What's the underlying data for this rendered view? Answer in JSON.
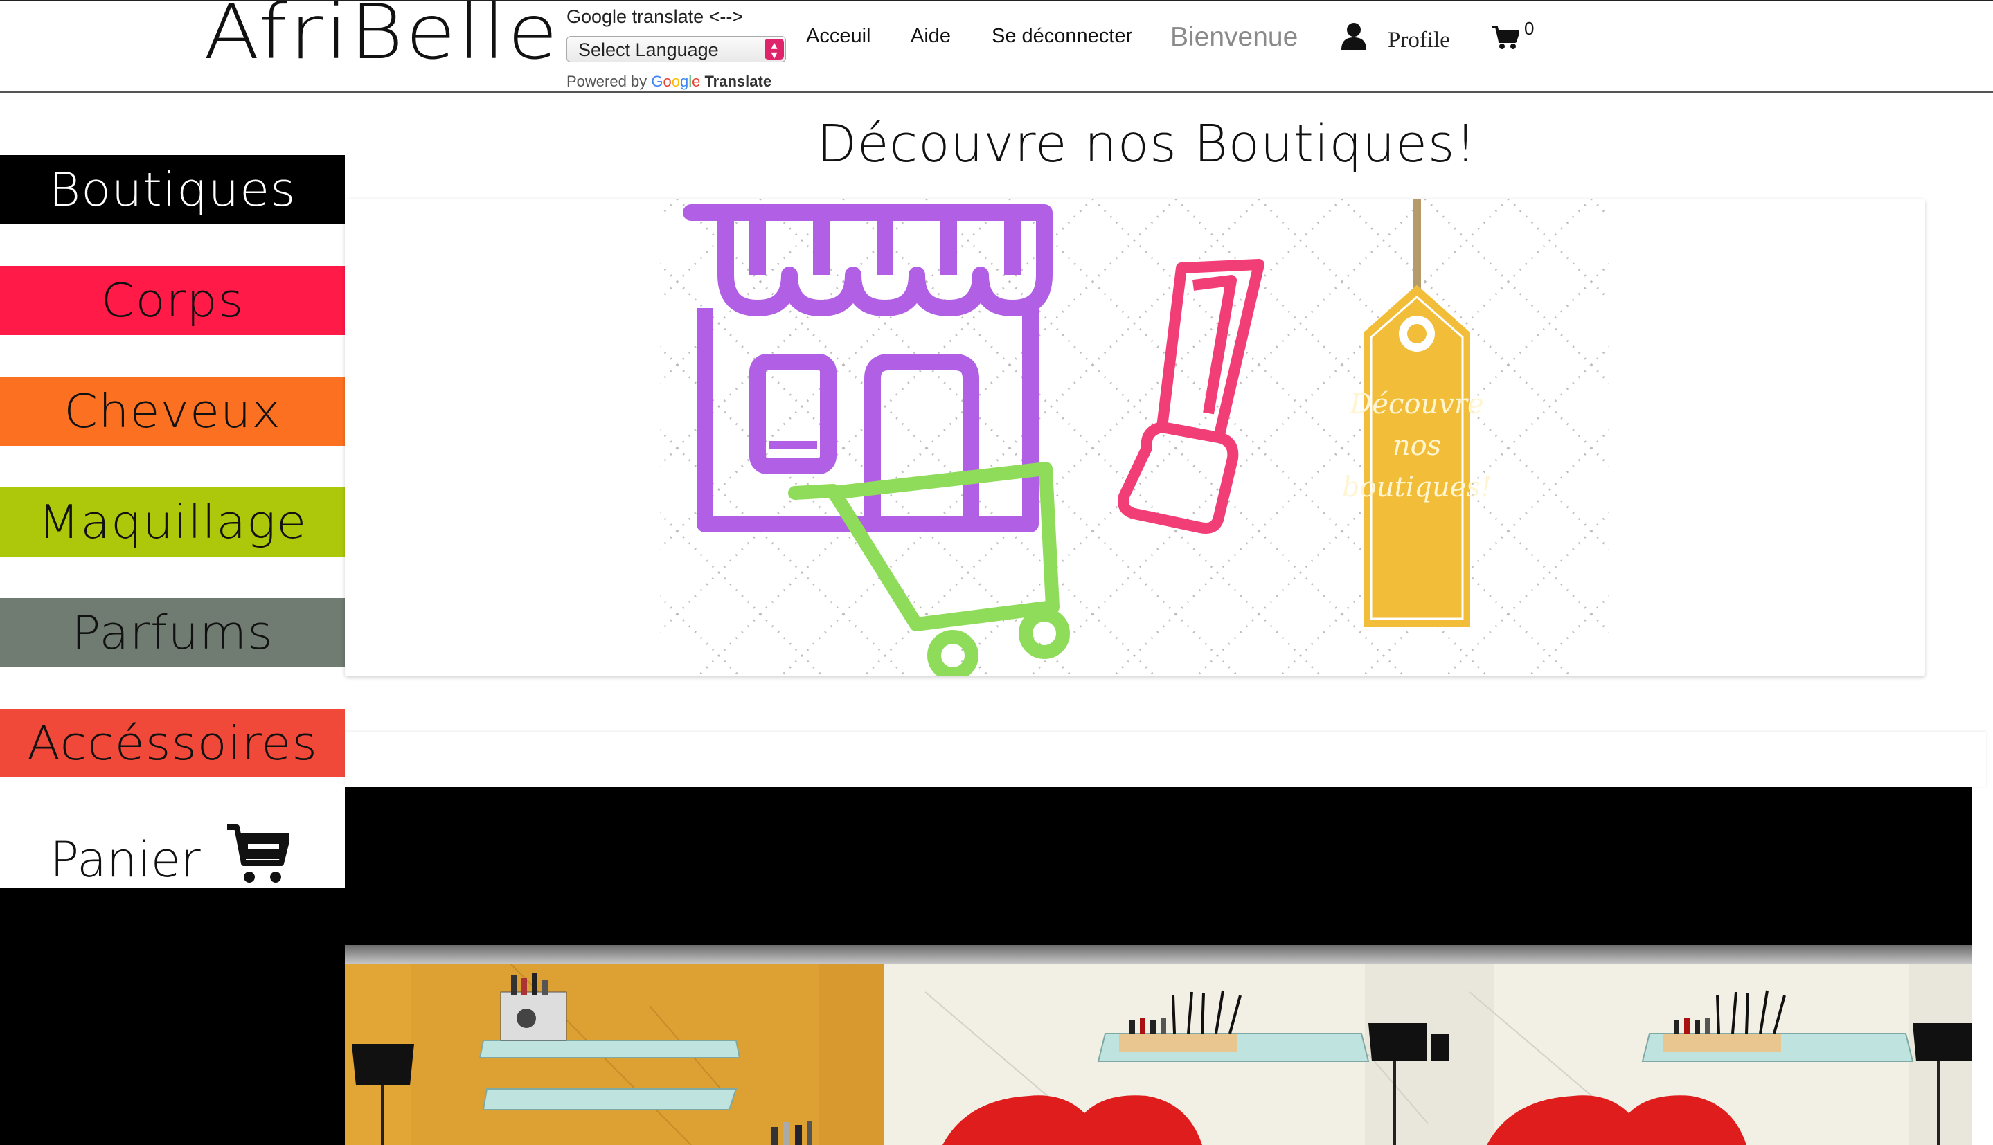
{
  "header": {
    "logo": "AfriBelle",
    "google_translate": {
      "label": "Google translate <-->",
      "select_value": "Select Language",
      "powered_by": "Powered by",
      "google": [
        "G",
        "o",
        "o",
        "g",
        "l",
        "e"
      ],
      "translate": "Translate"
    },
    "nav": {
      "accueil": "Acceuil",
      "aide": "Aide",
      "logout": "Se déconnecter",
      "welcome": "Bienvenue",
      "profile": "Profile",
      "cart_count": "0"
    }
  },
  "sidebar": {
    "items": [
      {
        "label": "Boutiques",
        "color": "#000000",
        "text_color": "#ffffff"
      },
      {
        "label": "Corps",
        "color": "#ff1a47",
        "text_color": "#111111"
      },
      {
        "label": "Cheveux",
        "color": "#fc7121",
        "text_color": "#111111"
      },
      {
        "label": "Maquillage",
        "color": "#adc80a",
        "text_color": "#111111"
      },
      {
        "label": "Parfums",
        "color": "#707b72",
        "text_color": "#111111"
      },
      {
        "label": "Accéssoires",
        "color": "#f0493a",
        "text_color": "#111111"
      }
    ],
    "cart_label": "Panier"
  },
  "main": {
    "title": "Découvre nos Boutiques!",
    "banner": {
      "tag_text_1": "Découvre",
      "tag_text_2": "nos",
      "tag_text_3": "boutiques!",
      "colors": {
        "shop": "#b15fe4",
        "cart": "#8fdc5a",
        "lipstick": "#f23e77",
        "tag": "#f2bd38"
      }
    }
  }
}
